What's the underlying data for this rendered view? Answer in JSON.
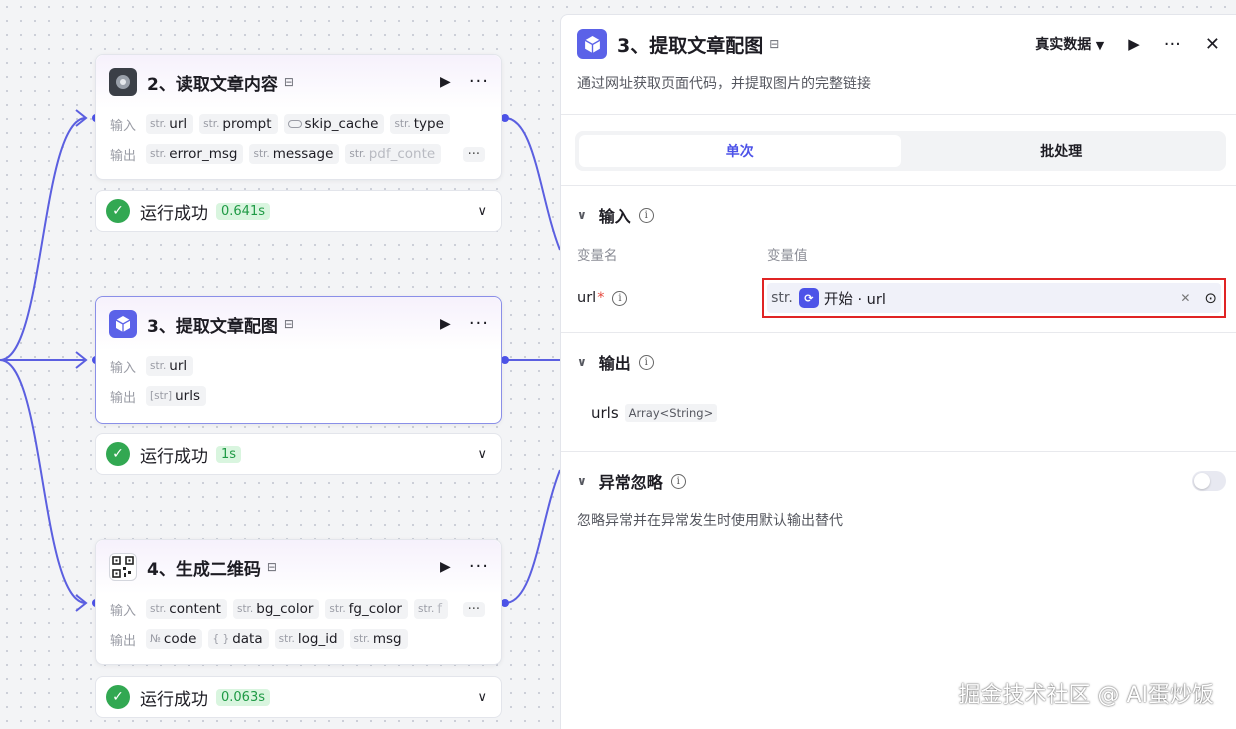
{
  "nodes": [
    {
      "title": "2、读取文章内容",
      "icon": "photo-icon",
      "input_label": "输入",
      "output_label": "输出",
      "inputs": [
        {
          "type": "str.",
          "name": "url"
        },
        {
          "type": "str.",
          "name": "prompt"
        },
        {
          "type": "toggle",
          "name": "skip_cache"
        },
        {
          "type": "str.",
          "name": "type"
        }
      ],
      "outputs": [
        {
          "type": "str.",
          "name": "error_msg"
        },
        {
          "type": "str.",
          "name": "message"
        },
        {
          "type": "str.",
          "name": "pdf_conte"
        }
      ],
      "more": "···",
      "status": "运行成功",
      "time": "0.641s"
    },
    {
      "title": "3、提取文章配图",
      "icon": "cube-icon",
      "input_label": "输入",
      "output_label": "输出",
      "inputs": [
        {
          "type": "str.",
          "name": "url"
        }
      ],
      "outputs": [
        {
          "type": "[str]",
          "name": "urls"
        }
      ],
      "status": "运行成功",
      "time": "1s"
    },
    {
      "title": "4、生成二维码",
      "icon": "qr-code-icon",
      "input_label": "输入",
      "output_label": "输出",
      "inputs": [
        {
          "type": "str.",
          "name": "content"
        },
        {
          "type": "str.",
          "name": "bg_color"
        },
        {
          "type": "str.",
          "name": "fg_color"
        },
        {
          "type": "str.",
          "name": "f"
        }
      ],
      "outputs": [
        {
          "type": "№",
          "name": "code"
        },
        {
          "type": "{ }",
          "name": "data"
        },
        {
          "type": "str.",
          "name": "log_id"
        },
        {
          "type": "str.",
          "name": "msg"
        }
      ],
      "more": "···",
      "status": "运行成功",
      "time": "0.063s"
    }
  ],
  "panel": {
    "title": "3、提取文章配图",
    "mode": "真实数据",
    "description": "通过网址获取页面代码，并提取图片的完整链接",
    "tabs": [
      "单次",
      "批处理"
    ],
    "input_section": {
      "title": "输入",
      "col_name": "变量名",
      "col_value": "变量值",
      "var_name": "url",
      "required_mark": "*",
      "value_type": "str.",
      "value_ref": "开始 · url"
    },
    "output_section": {
      "title": "输出",
      "name": "urls",
      "type": "Array<String>"
    },
    "exception_section": {
      "title": "异常忽略",
      "description": "忽略异常并在异常发生时使用默认输出替代",
      "enabled": false
    }
  },
  "watermark": "掘金技术社区 @ AI蛋炒饭",
  "colors": {
    "accent": "#4d53e8",
    "edge": "#5b5fe0",
    "success": "#32a852",
    "highlight_box": "#e02424"
  }
}
